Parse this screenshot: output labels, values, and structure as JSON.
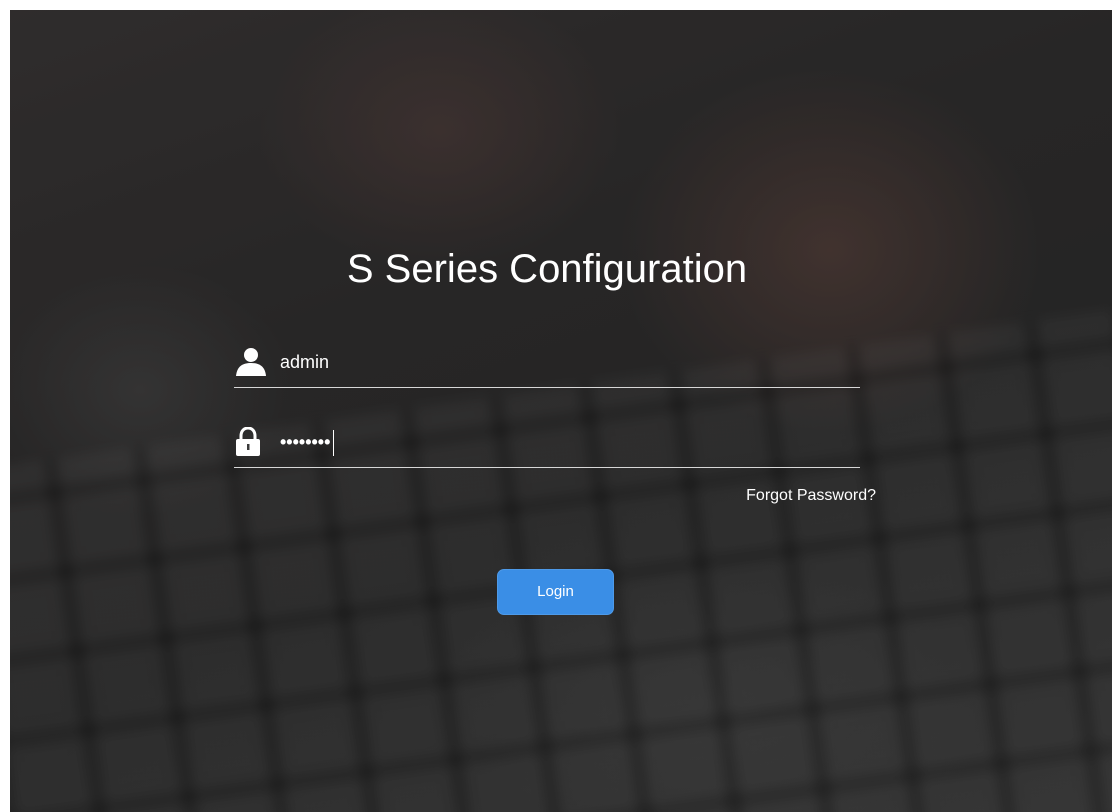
{
  "login": {
    "title": "S Series Configuration",
    "username": {
      "icon": "user-icon",
      "value": "admin"
    },
    "password": {
      "icon": "lock-icon",
      "masked_value": "••••••••"
    },
    "forgot_link": "Forgot Password?",
    "login_label": "Login"
  },
  "colors": {
    "button": "#3a8ee6",
    "text": "#ffffff"
  }
}
